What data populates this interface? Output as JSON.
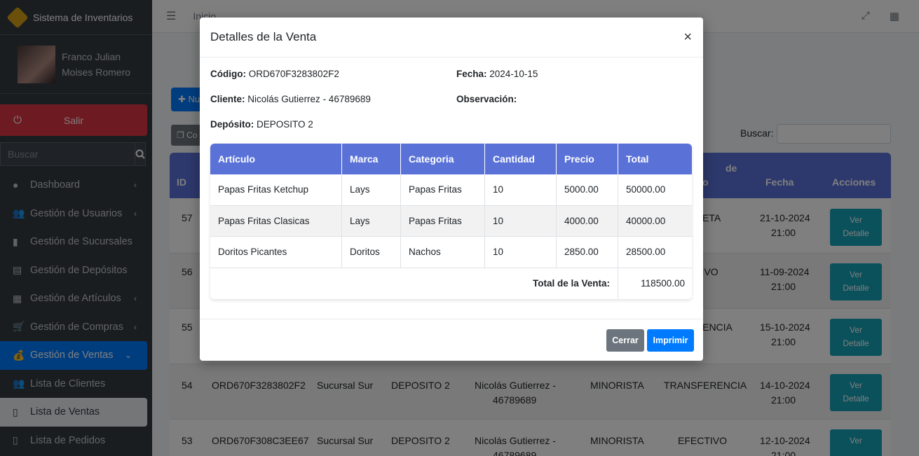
{
  "app": {
    "brand": "Sistema de Inventarios"
  },
  "user": {
    "name_line1": "Franco Julian",
    "name_line2": "Moises Romero"
  },
  "sidebar": {
    "logout_label": "Salir",
    "search_placeholder": "Buscar",
    "items": [
      {
        "label": "Dashboard",
        "icon": "palette-icon"
      },
      {
        "label": "Gestión de Usuarios",
        "icon": "users-icon"
      },
      {
        "label": "Gestión de Sucursales",
        "icon": "building-icon"
      },
      {
        "label": "Gestión de Depósitos",
        "icon": "warehouse-icon"
      },
      {
        "label": "Gestión de Artículos",
        "icon": "boxes-icon"
      },
      {
        "label": "Gestión de Compras",
        "icon": "cart-icon"
      },
      {
        "label": "Gestión de Ventas",
        "icon": "money-bag-icon"
      },
      {
        "label": "Lista de Clientes",
        "icon": "users-icon"
      },
      {
        "label": "Lista de Ventas",
        "icon": "file-icon"
      },
      {
        "label": "Lista de Pedidos",
        "icon": "file-icon"
      }
    ]
  },
  "topbar": {
    "link": "Inicio"
  },
  "main": {
    "new_button": "Nu",
    "copy_button": "Co",
    "search_label": "Buscar:",
    "headers": {
      "id": "ID",
      "col_de_top": "de",
      "col_de_bottom": "o",
      "fecha": "Fecha",
      "acciones": "Acciones"
    },
    "detail_button_line1": "Ver",
    "detail_button_line2": "Detalle",
    "rows": [
      {
        "id": "57",
        "partial": "ETA",
        "date": "21-10-2024",
        "time": "21:00"
      },
      {
        "id": "56",
        "partial": "TIVO",
        "date": "11-09-2024",
        "time": "21:00"
      },
      {
        "id": "55",
        "partial": "RENCIA",
        "date": "15-10-2024",
        "time": "21:00"
      },
      {
        "id": "54",
        "code": "ORD670F3283802F2",
        "branch": "Sucursal Sur",
        "depot": "DEPOSITO 2",
        "client_line1": "Nicolás Gutierrez -",
        "client_line2": "46789689",
        "type": "MINORISTA",
        "payment": "TRANSFERENCIA",
        "date": "14-10-2024",
        "time": "21:00"
      },
      {
        "id": "53",
        "code": "ORD670F308C3EE67",
        "branch": "Sucursal Sur",
        "depot": "DEPOSITO 2",
        "client_line1": "Nicolás Gutierrez -",
        "client_line2": "46789689",
        "type": "MINORISTA",
        "payment": "EFECTIVO",
        "date": "12-10-2024",
        "time": "21:00"
      }
    ]
  },
  "modal": {
    "title": "Detalles de la Venta",
    "close_symbol": "×",
    "codigo_label": "Código:",
    "codigo_value": "ORD670F3283802F2",
    "fecha_label": "Fecha:",
    "fecha_value": "2024-10-15",
    "cliente_label": "Cliente:",
    "cliente_value": "Nicolás Gutierrez - 46789689",
    "observacion_label": "Observación:",
    "deposito_label": "Depósito:",
    "deposito_value": "DEPOSITO 2",
    "columns": [
      "Artículo",
      "Marca",
      "Categoria",
      "Cantidad",
      "Precio",
      "Total"
    ],
    "items": [
      {
        "articulo": "Papas Fritas Ketchup",
        "marca": "Lays",
        "categoria": "Papas Fritas",
        "cantidad": "10",
        "precio": "5000.00",
        "total": "50000.00"
      },
      {
        "articulo": "Papas Fritas Clasicas",
        "marca": "Lays",
        "categoria": "Papas Fritas",
        "cantidad": "10",
        "precio": "4000.00",
        "total": "40000.00"
      },
      {
        "articulo": "Doritos Picantes",
        "marca": "Doritos",
        "categoria": "Nachos",
        "cantidad": "10",
        "precio": "2850.00",
        "total": "28500.00"
      }
    ],
    "total_label": "Total de la Venta:",
    "total_value": "118500.00",
    "cerrar_button": "Cerrar",
    "imprimir_button": "Imprimir"
  }
}
